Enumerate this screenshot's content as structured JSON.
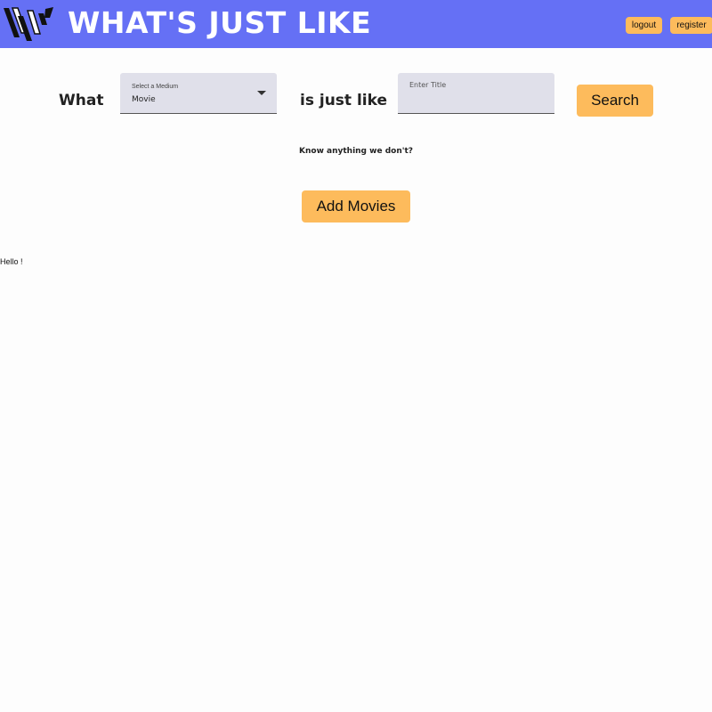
{
  "header": {
    "title": "WHAT'S JUST LIKE",
    "logout_label": "logout",
    "register_label": "register",
    "background_color": "#6570f5",
    "logo_icon": "wjl-logo-icon"
  },
  "search": {
    "what_label": "What",
    "medium_label": "Select a Medium",
    "medium_value": "Movie",
    "dropdown_icon": "chevron-down-icon",
    "is_just_like_label": "is just like",
    "title_placeholder": "Enter Title",
    "title_value": "",
    "search_label": "Search"
  },
  "contribute": {
    "prompt": "Know anything we don't?",
    "add_label": "Add Movies"
  },
  "greeting": "Hello !",
  "colors": {
    "accent": "#fdbb5c",
    "field_background": "#e0e0ea"
  }
}
